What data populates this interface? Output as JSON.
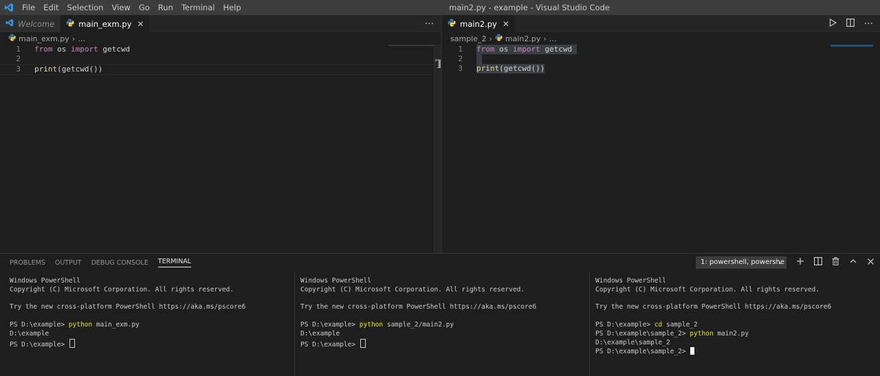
{
  "window": {
    "title": "main2.py - example - Visual Studio Code",
    "menu": [
      "File",
      "Edit",
      "Selection",
      "View",
      "Go",
      "Run",
      "Terminal",
      "Help"
    ]
  },
  "left_group": {
    "tabs": [
      {
        "label": "Welcome",
        "active": false
      },
      {
        "label": "main_exm.py",
        "active": true
      }
    ],
    "more": "···",
    "breadcrumb": {
      "file": "main_exm.py",
      "rest": "…"
    },
    "lines": [
      {
        "n": "1",
        "kw1": "from",
        "mod": " os ",
        "kw2": "import",
        "name": " getcwd"
      },
      {
        "n": "2"
      },
      {
        "n": "3",
        "fn": "print",
        "args": "(getcwd())"
      }
    ]
  },
  "right_group": {
    "tabs": [
      {
        "label": "main2.py",
        "active": true
      }
    ],
    "breadcrumb": {
      "folder": "sample_2",
      "sep": "›",
      "file": "main2.py",
      "rest": "…"
    },
    "lines": [
      {
        "n": "1",
        "kw1": "from",
        "mod": " os ",
        "kw2": "import",
        "name": " getcwd "
      },
      {
        "n": "2"
      },
      {
        "n": "3",
        "fn": "print",
        "args": "(getcwd())"
      }
    ]
  },
  "panel": {
    "tabs": [
      "PROBLEMS",
      "OUTPUT",
      "DEBUG CONSOLE",
      "TERMINAL"
    ],
    "active_tab": "TERMINAL",
    "terminal_select": "1: powershell, powershe"
  },
  "terminals": [
    {
      "header": [
        "Windows PowerShell",
        "Copyright (C) Microsoft Corporation. All rights reserved.",
        "",
        "Try the new cross-platform PowerShell https://aka.ms/pscore6",
        ""
      ],
      "p1": "PS D:\\example> ",
      "c1": "python",
      "a1": " main_exm.py",
      "out1": "D:\\example",
      "p2": "PS D:\\example> "
    },
    {
      "header": [
        "Windows PowerShell",
        "Copyright (C) Microsoft Corporation. All rights reserved.",
        "",
        "Try the new cross-platform PowerShell https://aka.ms/pscore6",
        ""
      ],
      "p1": "PS D:\\example> ",
      "c1": "python",
      "a1": " sample_2/main2.py",
      "out1": "D:\\example",
      "p2": "PS D:\\example> "
    },
    {
      "header": [
        "Windows PowerShell",
        "Copyright (C) Microsoft Corporation. All rights reserved.",
        "",
        "Try the new cross-platform PowerShell https://aka.ms/pscore6",
        ""
      ],
      "p1": "PS D:\\example> ",
      "c1": "cd",
      "a1": " sample_2",
      "p2": "PS D:\\example\\sample_2> ",
      "c2": "python",
      "a2": " main2.py",
      "out1": "D:\\example\\sample_2",
      "p3": "PS D:\\example\\sample_2> "
    }
  ],
  "colors": {
    "accent": "#007acc",
    "keyword": "#c586c0",
    "function": "#dcdcaa",
    "terminal_cmd": "#e5e510"
  }
}
